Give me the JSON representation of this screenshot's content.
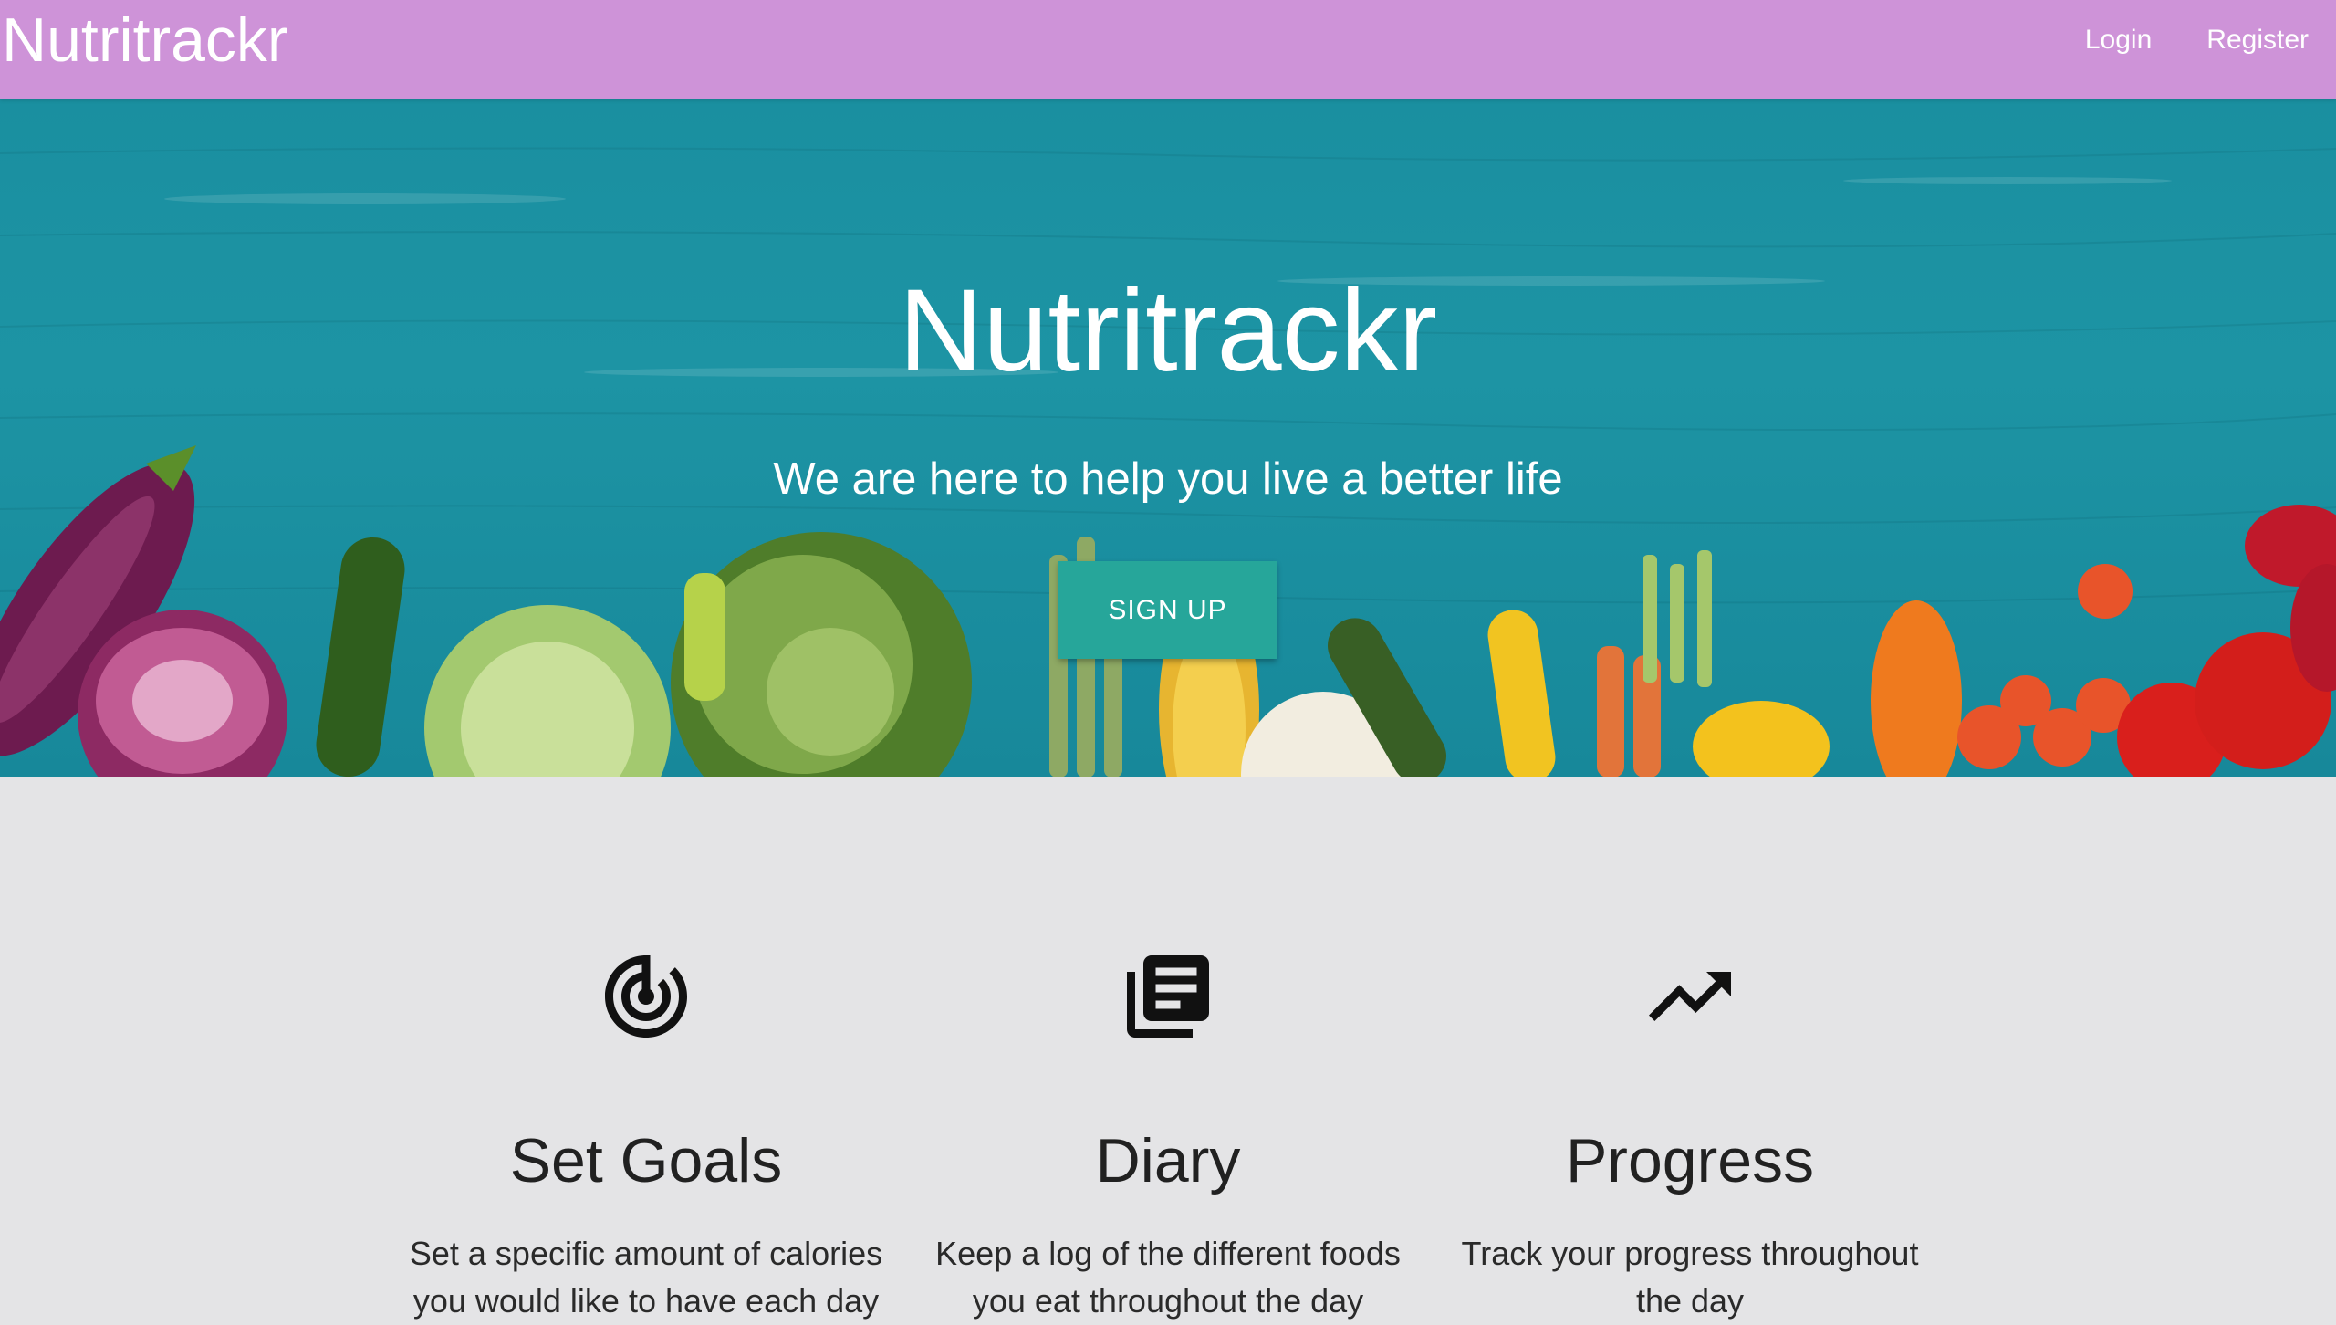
{
  "navbar": {
    "brand": "Nutritrackr",
    "links": [
      "Login",
      "Register"
    ]
  },
  "hero": {
    "title": "Nutritrackr",
    "subtitle": "We are here to help you live a better life",
    "signup_label": "SIGN UP"
  },
  "features": [
    {
      "icon": "track-changes-icon",
      "title": "Set Goals",
      "description": "Set a specific amount of calories you would like to have each day"
    },
    {
      "icon": "library-books-icon",
      "title": "Diary",
      "description": "Keep a log of the different foods you eat throughout the day"
    },
    {
      "icon": "trending-up-icon",
      "title": "Progress",
      "description": "Track your progress throughout the day"
    }
  ],
  "colors": {
    "navbar": "#ce93d8",
    "hero_background": "#1a8fa0",
    "signup_button": "#26a69a",
    "features_background": "#e4e4e6"
  }
}
